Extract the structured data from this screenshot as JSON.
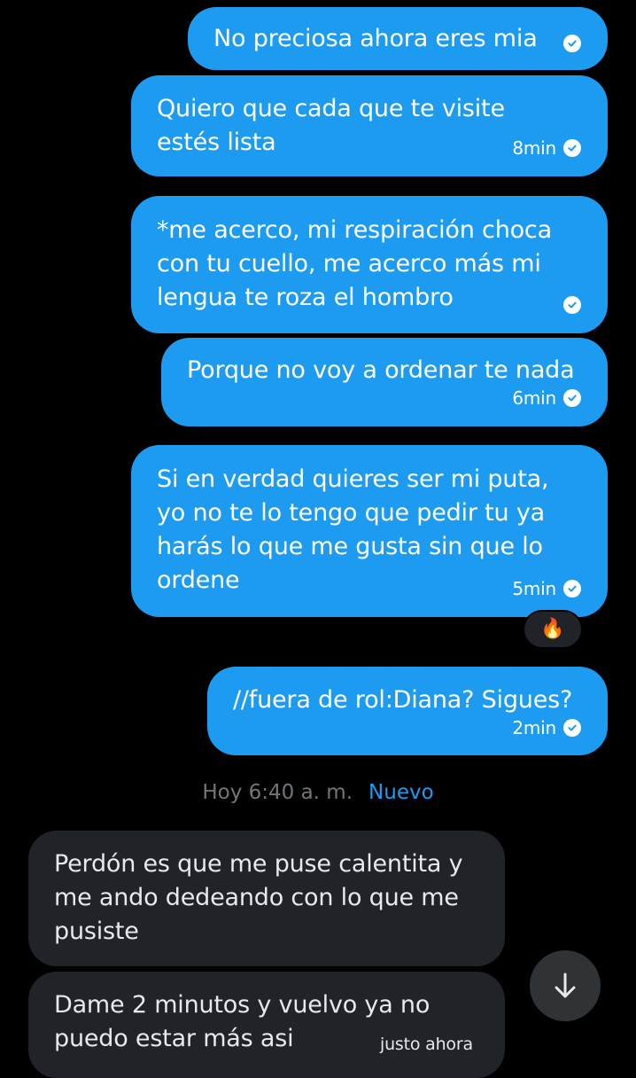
{
  "messages": [
    {
      "text": "No preciosa ahora eres mia",
      "time": ""
    },
    {
      "text": "Quiero que cada que te visite\nestés lista",
      "time": "8min"
    },
    {
      "text": "*me acerco, mi respiración choca\ncon tu cuello, me acerco más mi\nlengua te roza el hombro",
      "time": ""
    },
    {
      "text": "Porque no voy a ordenar te nada",
      "time": "6min"
    },
    {
      "text": "Si en verdad quieres ser mi puta,\nyo  no te lo tengo que pedir tu ya\nharás lo que me gusta sin que lo\nordene",
      "time": "5min"
    },
    {
      "text": "//fuera de rol:Diana? Sigues?",
      "time": "2min"
    }
  ],
  "reaction": {
    "emoji": "🔥"
  },
  "divider": {
    "time": "Hoy 6:40 a. m.",
    "new_label": "Nuevo"
  },
  "incoming": [
    {
      "text": "Perdón es que me puse calentita y\nme ando dedeando con lo que me\npusiste",
      "time": ""
    },
    {
      "text": "Dame 2 minutos y vuelvo ya no\npuedo estar más asi",
      "time": "justo ahora"
    }
  ],
  "colors": {
    "background": "#000000",
    "outgoing_bubble": "#1d9bf0",
    "incoming_bubble": "#202327",
    "new_label": "#1d9bf0",
    "muted_text": "#71767b"
  },
  "icons": {
    "read_receipt": "check-circle-icon",
    "scroll_down": "arrow-down-icon",
    "reaction": "fire-emoji"
  }
}
